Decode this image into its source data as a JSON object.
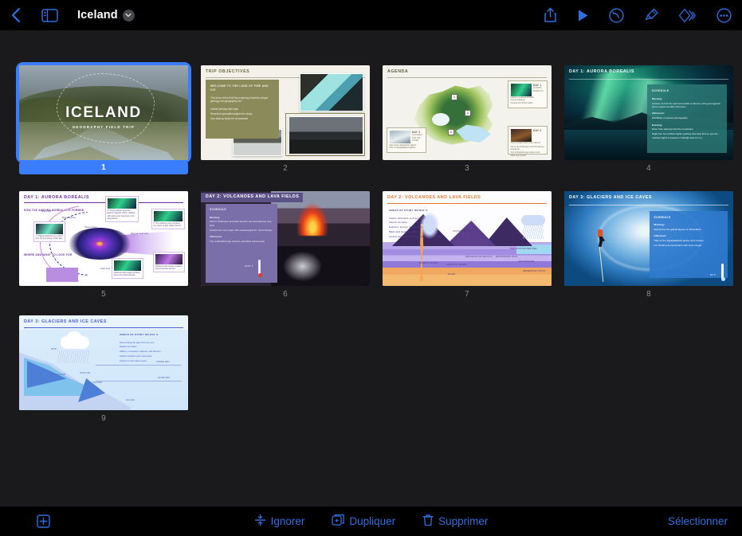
{
  "toolbar": {
    "back_icon": "chevron-left-icon",
    "sidebar_icon": "sidebar-toggle-icon",
    "title": "Iceland",
    "title_chevron_icon": "chevron-down-icon",
    "actions": [
      {
        "name": "share-icon",
        "label": "Partager"
      },
      {
        "name": "play-icon",
        "label": "Lire"
      },
      {
        "name": "undo-icon",
        "label": "Annuler"
      },
      {
        "name": "format-brush-icon",
        "label": "Format"
      },
      {
        "name": "animate-icon",
        "label": "Animer"
      },
      {
        "name": "more-icon",
        "label": "Plus"
      }
    ],
    "accent_color": "#2f6fe0",
    "title_color": "#ffffff"
  },
  "bottom_bar": {
    "add_icon": "add-slide-icon",
    "items": [
      {
        "name": "skip-button",
        "icon": "skip-slide-icon",
        "label": "Ignorer"
      },
      {
        "name": "duplicate-button",
        "icon": "duplicate-icon",
        "label": "Dupliquer"
      },
      {
        "name": "delete-button",
        "icon": "trash-icon",
        "label": "Supprimer"
      }
    ],
    "select_label": "Sélectionner",
    "accent_color": "#2f6fe0"
  },
  "navigator": {
    "selected_index": 1,
    "selection_color": "#3b7dff",
    "background_color": "#1a1a1c",
    "slides": [
      {
        "number": "1",
        "kind": "title-photo",
        "title": "ICELAND",
        "subtitle": "GEOGRAPHY FIELD TRIP"
      },
      {
        "number": "2",
        "kind": "objectives",
        "title": "TRIP OBJECTIVES",
        "box_heading": "WELCOME TO THE LAND OF FIRE AND ICE",
        "box_paragraph": "The aims of this field trip exploring Iceland's unique geology and geography are:",
        "bullets": [
          "Gather primary field data",
          "Research specialist subject for essay",
          "Use data as basis for coursework"
        ]
      },
      {
        "number": "3",
        "kind": "agenda-map",
        "title": "AGENDA",
        "pins": [
          "1",
          "2",
          "3"
        ],
        "cards": [
          {
            "day": "DAY 1",
            "subject": "AURORA BOREALIS",
            "bullets": [
              "Lecture on aurora borealis",
              "Aurora drawings",
              "Viewing of northern lights"
            ]
          },
          {
            "day": "DAY 2",
            "subject": "VOLCANOES AND LAVA FIELDS",
            "bullets": [
              "Trip to the Holuhraun and Nornahraun lava fields",
              "Visit to Bardarbunga volcano and black sand beach"
            ]
          },
          {
            "day": "DAY 3",
            "subject": "GLACIERS AND ICE CAVES",
            "bullets": [
              "Sail across Jökulsárlón lagoon",
              "Hike on Eyjafjallajökull glacier"
            ]
          }
        ]
      },
      {
        "number": "4",
        "kind": "day-photo",
        "title": "DAY 1: AURORA BOREALIS",
        "panel_heading": "SCHEDULE",
        "sections": [
          {
            "label": "Morning:",
            "items": [
              "Lecture on how the aurora borealis is formed, with geomagnetic storm expert Jennifer Sorensen"
            ]
          },
          {
            "label": "Afternoon:",
            "items": [
              "Exhibition on aurora photography"
            ]
          },
          {
            "label": "Evening:",
            "items": [
              "Drive from Akureyri into the mountains",
              "Night tour for northern lights spotting (the best time to see the northern lights is between midnight and 2 a.m.)"
            ]
          }
        ]
      },
      {
        "number": "5",
        "kind": "aurora-diagram",
        "title": "DAY 1: AURORA BOREALIS",
        "section_1": "HOW THE AURORA BOREALIS IS FORMED",
        "section_2": "WHERE AND WHAT TO LOOK FOR",
        "labels": [
          "Bow shock",
          "Magnetopause",
          "Plasma sheet",
          "Van Allen belts",
          "Magnetic field lines",
          "Solar wind"
        ],
        "cards": [
          "1. Charged particles are emitted from the sun during a solar flare.",
          "2. These particles generate Earth's magnetic shield, colliding with atoms and molecules in the atmosphere.",
          "3. The collisions emit countless tiny bursts of light called photons.",
          "Collisions with oxygen produce green and yellow auroras.",
          "Collisions with nitrogen produce pink and purple auroras."
        ]
      },
      {
        "number": "6",
        "kind": "day-photo",
        "title": "DAY 2: VOLCANOES AND LAVA FIELDS",
        "panel_heading": "SCHEDULE",
        "temperature": "2010° F",
        "sections": [
          {
            "label": "Morning:",
            "items": [
              "Visit to Holuhraun lava field and the new Nornahraun lava field",
              "Guided tour of a crater with volcanologist Dr. Grant Phelps"
            ]
          },
          {
            "label": "Afternoon:",
            "items": [
              "Trip to Bárðarbunga volcano and black sand beach"
            ]
          }
        ]
      },
      {
        "number": "7",
        "kind": "volcano-diagram",
        "title": "DAY 2: VOLCANOES AND LAVA FIELDS",
        "heading": "AREAS OF STUDY ON DAY 2:",
        "bullets": [
          "Craters, lava tubes, and lava fields",
          "Volcano formation",
          "Eruptions, fissures, and structure",
          "Black sand beach formation",
          "Impacts lava fields and volcanoes have on the land"
        ],
        "labels": [
          "VOLCANIC ASH",
          "LAVA",
          "ASH FALL",
          "PRECIPITATION WEATHER",
          "EXPLOSIVE GAS BUILD-UP",
          "METAMORPHIC ROCK",
          "CRYSTALS / MAGMA",
          "BASALTIC LAYERS",
          "GROUNDWATER",
          "SEDIMENTARY ROCKS",
          "MAGMA"
        ]
      },
      {
        "number": "8",
        "kind": "day-photo",
        "title": "DAY 3: GLACIERS AND ICE CAVES",
        "panel_heading": "SCHEDULE",
        "temperature": "10° F",
        "sections": [
          {
            "label": "Morning:",
            "items": [
              "Sail across the glacial lagoon of Jökulsárlón"
            ]
          },
          {
            "label": "Afternoon:",
            "items": [
              "Hike on the Eyjafjallajökull glacier and volcano",
              "Ice climbing demonstration with Kevin Angel"
            ]
          }
        ]
      },
      {
        "number": "9",
        "kind": "glacier-diagram",
        "title": "DAY 3: GLACIERS AND ICE CAVES",
        "heading": "AREAS OF STUDY ON DAY 3:",
        "bullets": [
          "Determining the age of an ice core",
          "Glacier formation",
          "Valleys, crevasses, calquas, and fissures",
          "Glacier behavior and movement",
          "Impact on sea water levels"
        ],
        "labels": [
          "SNOW",
          "ACCUMULATION",
          "SNOW LINE",
          "CREVASSE",
          "SUMMER MELT",
          "WINTER MELT",
          "ICE CAVE"
        ]
      }
    ]
  }
}
